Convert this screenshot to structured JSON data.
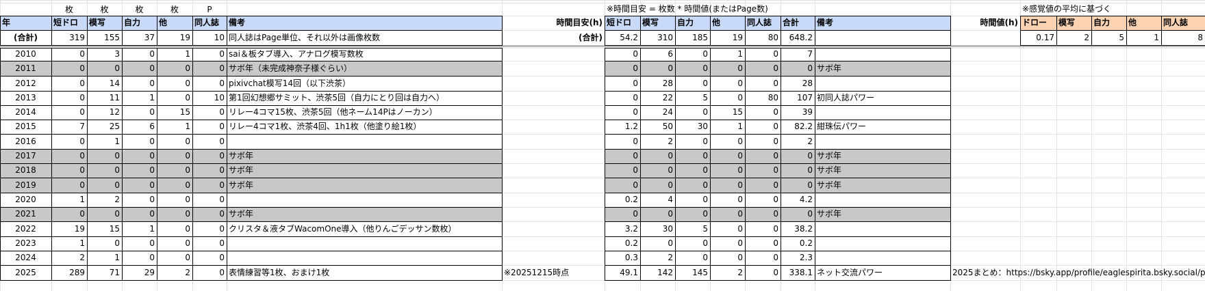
{
  "colors": {
    "header_blue": "#c9daf8",
    "header_orange": "#fbd3b2",
    "off_year_gray": "#c8c8c8",
    "grid": "#e2e2e2",
    "border": "#000000"
  },
  "units_row": [
    "枚",
    "枚",
    "枚",
    "枚",
    "P"
  ],
  "table1": {
    "headers": [
      "年",
      "短ドロ",
      "模写",
      "自力",
      "他",
      "同人誌",
      "備考"
    ],
    "total": [
      "(合計)",
      "319",
      "155",
      "37",
      "19",
      "10",
      "同人誌はPage単位、それ以外は画像枚数"
    ]
  },
  "table2": {
    "note": "※時間目安 = 枚数 * 時間値(またはPage数)",
    "row_label": "時間目安(h)",
    "headers": [
      "短ドロ",
      "模写",
      "自力",
      "他",
      "同人誌",
      "合計",
      "備考"
    ],
    "total_label": "(合計)",
    "total": [
      "54.2",
      "310",
      "185",
      "19",
      "80",
      "648.2",
      ""
    ]
  },
  "table3": {
    "note": "※感覚値の平均に基づく",
    "row_label": "時間値(h)",
    "headers": [
      "ドロー",
      "模写",
      "自力",
      "他",
      "同人誌"
    ],
    "values": [
      "0.17",
      "2",
      "5",
      "1",
      "8"
    ]
  },
  "rows": [
    {
      "year": "2010",
      "vals": [
        "0",
        "3",
        "0",
        "1",
        "0"
      ],
      "memo": "sai＆板タブ導入、アナログ模写数枚",
      "mid": "",
      "hours": [
        "0",
        "6",
        "0",
        "1",
        "0",
        "7"
      ],
      "hmemo": "",
      "far": "",
      "gray": false
    },
    {
      "year": "2011",
      "vals": [
        "0",
        "0",
        "0",
        "0",
        "0"
      ],
      "memo": "サボ年（未完成神奈子様ぐらい）",
      "mid": "",
      "hours": [
        "0",
        "0",
        "0",
        "0",
        "0",
        "0"
      ],
      "hmemo": "サボ年",
      "far": "",
      "gray": true
    },
    {
      "year": "2012",
      "vals": [
        "0",
        "14",
        "0",
        "0",
        "0"
      ],
      "memo": "pixivchat模写14回（以下渋茶）",
      "mid": "",
      "hours": [
        "0",
        "28",
        "0",
        "0",
        "0",
        "28"
      ],
      "hmemo": "",
      "far": "",
      "gray": false
    },
    {
      "year": "2013",
      "vals": [
        "0",
        "11",
        "1",
        "0",
        "10"
      ],
      "memo": "第1回幻想郷サミット、渋茶5回（自力にとり回は自力へ）",
      "mid": "",
      "hours": [
        "0",
        "22",
        "5",
        "0",
        "80",
        "107"
      ],
      "hmemo": "初同人誌パワー",
      "far": "",
      "gray": false
    },
    {
      "year": "2014",
      "vals": [
        "0",
        "12",
        "0",
        "15",
        "0"
      ],
      "memo": "リレー4コマ15枚、渋茶5回（他ネーム14Pはノーカン）",
      "mid": "",
      "hours": [
        "0",
        "24",
        "0",
        "15",
        "0",
        "39"
      ],
      "hmemo": "",
      "far": "",
      "gray": false
    },
    {
      "year": "2015",
      "vals": [
        "7",
        "25",
        "6",
        "1",
        "0"
      ],
      "memo": "リレー4コマ1枚、渋茶4回、1h1枚（他塗り絵1枚）",
      "mid": "",
      "hours": [
        "1.2",
        "50",
        "30",
        "1",
        "0",
        "82.2"
      ],
      "hmemo": "紺珠伝パワー",
      "far": "",
      "gray": false
    },
    {
      "year": "2016",
      "vals": [
        "0",
        "1",
        "0",
        "0",
        "0"
      ],
      "memo": "",
      "mid": "",
      "hours": [
        "0",
        "2",
        "0",
        "0",
        "0",
        "2"
      ],
      "hmemo": "",
      "far": "",
      "gray": false
    },
    {
      "year": "2017",
      "vals": [
        "0",
        "0",
        "0",
        "0",
        "0"
      ],
      "memo": "サボ年",
      "mid": "",
      "hours": [
        "0",
        "0",
        "0",
        "0",
        "0",
        "0"
      ],
      "hmemo": "サボ年",
      "far": "",
      "gray": true
    },
    {
      "year": "2018",
      "vals": [
        "0",
        "0",
        "0",
        "0",
        "0"
      ],
      "memo": "サボ年",
      "mid": "",
      "hours": [
        "0",
        "0",
        "0",
        "0",
        "0",
        "0"
      ],
      "hmemo": "サボ年",
      "far": "",
      "gray": true
    },
    {
      "year": "2019",
      "vals": [
        "0",
        "0",
        "0",
        "0",
        "0"
      ],
      "memo": "サボ年",
      "mid": "",
      "hours": [
        "0",
        "0",
        "0",
        "0",
        "0",
        "0"
      ],
      "hmemo": "サボ年",
      "far": "",
      "gray": true
    },
    {
      "year": "2020",
      "vals": [
        "1",
        "2",
        "0",
        "0",
        "0"
      ],
      "memo": "",
      "mid": "",
      "hours": [
        "0.2",
        "4",
        "0",
        "0",
        "0",
        "4.2"
      ],
      "hmemo": "",
      "far": "",
      "gray": false
    },
    {
      "year": "2021",
      "vals": [
        "0",
        "0",
        "0",
        "0",
        "0"
      ],
      "memo": "サボ年",
      "mid": "",
      "hours": [
        "0",
        "0",
        "0",
        "0",
        "0",
        "0"
      ],
      "hmemo": "サボ年",
      "far": "",
      "gray": true
    },
    {
      "year": "2022",
      "vals": [
        "19",
        "15",
        "1",
        "0",
        "0"
      ],
      "memo": "クリスタ＆液タブWacomOne導入（他りんごデッサン数枚）",
      "mid": "",
      "hours": [
        "3.2",
        "30",
        "5",
        "0",
        "0",
        "38.2"
      ],
      "hmemo": "",
      "far": "",
      "gray": false
    },
    {
      "year": "2023",
      "vals": [
        "1",
        "0",
        "0",
        "0",
        "0"
      ],
      "memo": "",
      "mid": "",
      "hours": [
        "0.2",
        "0",
        "0",
        "0",
        "0",
        "0.2"
      ],
      "hmemo": "",
      "far": "",
      "gray": false
    },
    {
      "year": "2024",
      "vals": [
        "2",
        "1",
        "0",
        "0",
        "0"
      ],
      "memo": "",
      "mid": "",
      "hours": [
        "0.3",
        "2",
        "0",
        "0",
        "0",
        "2.3"
      ],
      "hmemo": "",
      "far": "",
      "gray": false
    },
    {
      "year": "2025",
      "vals": [
        "289",
        "71",
        "29",
        "2",
        "0"
      ],
      "memo": "表情練習等1枚、おまけ1枚",
      "mid": "※20251215時点",
      "hours": [
        "49.1",
        "142",
        "145",
        "2",
        "0",
        "338.1"
      ],
      "hmemo": "ネット交流パワー",
      "far": "2025まとめ：https://bsky.app/profile/eaglespirita.bsky.social/p",
      "gray": false
    }
  ]
}
